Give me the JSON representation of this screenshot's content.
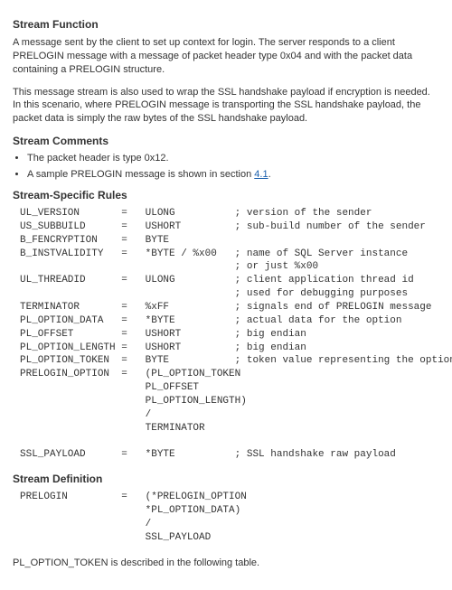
{
  "headings": {
    "stream_function": "Stream Function",
    "stream_comments": "Stream Comments",
    "stream_specific_rules": "Stream-Specific Rules",
    "stream_definition": "Stream Definition"
  },
  "paragraphs": {
    "func_p1": "A message sent by the client to set up context for login. The server responds to a client PRELOGIN message with a message of packet header type 0x04 and with the packet data containing a PRELOGIN structure.",
    "func_p2": "This message stream is also used to wrap the SSL handshake payload if encryption is needed. In this scenario, where PRELOGIN message is transporting the SSL handshake payload, the packet data is simply the raw bytes of the SSL handshake payload.",
    "footer": "PL_OPTION_TOKEN is described in the following table."
  },
  "comments": {
    "item1": "The packet header is type 0x12.",
    "item2_pre": "A sample PRELOGIN message is shown in section ",
    "item2_link": "4.1",
    "item2_post": "."
  },
  "grammar_rules": "UL_VERSION       =   ULONG          ; version of the sender\nUS_SUBBUILD      =   USHORT         ; sub-build number of the sender\nB_FENCRYPTION    =   BYTE\nB_INSTVALIDITY   =   *BYTE / %x00   ; name of SQL Server instance\n                                    ; or just %x00\nUL_THREADID      =   ULONG          ; client application thread id\n                                    ; used for debugging purposes\nTERMINATOR       =   %xFF           ; signals end of PRELOGIN message\nPL_OPTION_DATA   =   *BYTE          ; actual data for the option\nPL_OFFSET        =   USHORT         ; big endian\nPL_OPTION_LENGTH =   USHORT         ; big endian\nPL_OPTION_TOKEN  =   BYTE           ; token value representing the option\nPRELOGIN_OPTION  =   (PL_OPTION_TOKEN\n                     PL_OFFSET\n                     PL_OPTION_LENGTH)\n                     /\n                     TERMINATOR\n\nSSL_PAYLOAD      =   *BYTE          ; SSL handshake raw payload",
  "grammar_definition": "PRELOGIN         =   (*PRELOGIN_OPTION\n                     *PL_OPTION_DATA)\n                     /\n                     SSL_PAYLOAD"
}
